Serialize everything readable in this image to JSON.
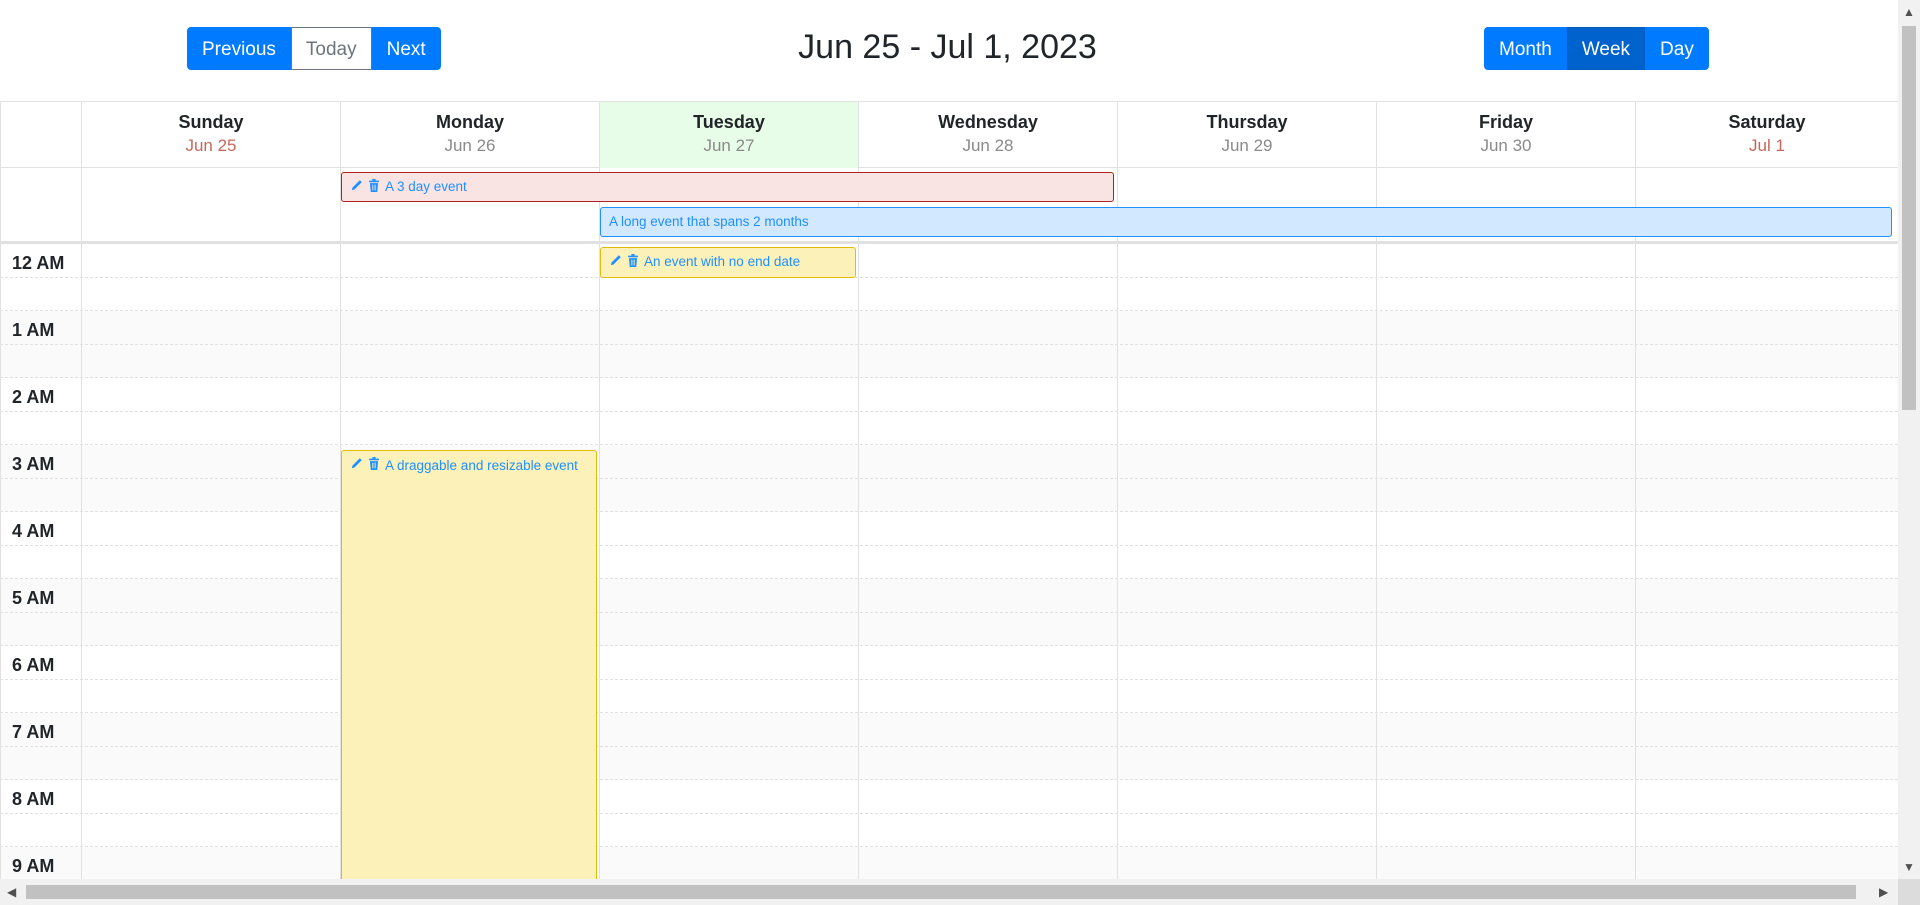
{
  "toolbar": {
    "previous": "Previous",
    "today": "Today",
    "next": "Next",
    "title": "Jun 25 - Jul 1, 2023",
    "views": [
      "Month",
      "Week",
      "Day"
    ],
    "active_view": "Week"
  },
  "days": [
    {
      "dow": "Sunday",
      "date": "Jun 25"
    },
    {
      "dow": "Monday",
      "date": "Jun 26"
    },
    {
      "dow": "Tuesday",
      "date": "Jun 27"
    },
    {
      "dow": "Wednesday",
      "date": "Jun 28"
    },
    {
      "dow": "Thursday",
      "date": "Jun 29"
    },
    {
      "dow": "Friday",
      "date": "Jun 30"
    },
    {
      "dow": "Saturday",
      "date": "Jul 1"
    }
  ],
  "events": {
    "three_day": "A 3 day event",
    "long": "A long event that spans 2 months",
    "no_end": "An event with no end date",
    "draggable": "A draggable and resizable event"
  },
  "hours": [
    "12 AM",
    "1 AM",
    "2 AM",
    "3 AM",
    "4 AM",
    "5 AM",
    "6 AM",
    "7 AM",
    "8 AM",
    "9 AM"
  ],
  "colors": {
    "primary": "#007bff",
    "today_bg": "#e8fde7",
    "event_red_bg": "#fae3e3",
    "event_blue_bg": "#d1e8ff",
    "event_yellow_bg": "#fdf1ba"
  }
}
